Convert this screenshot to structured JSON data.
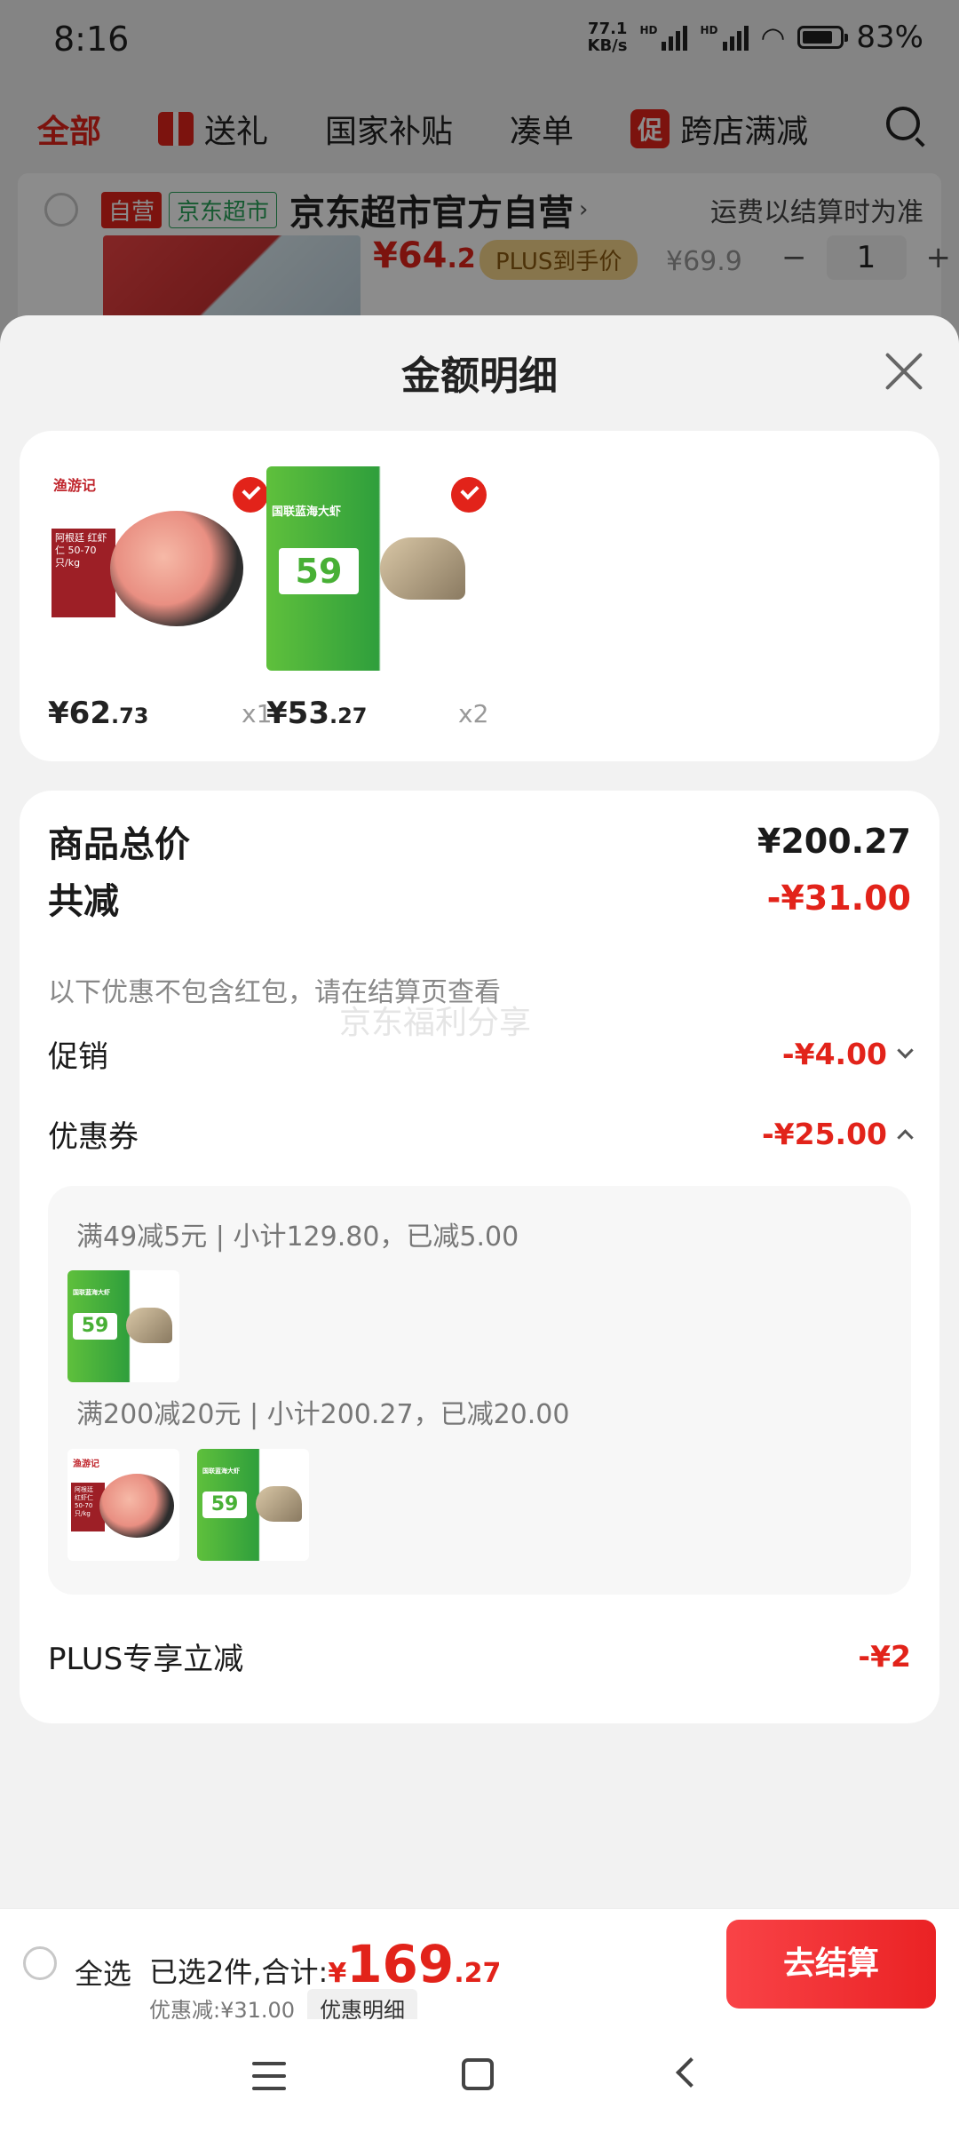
{
  "status": {
    "time": "8:16",
    "netspeed_value": "77.1",
    "netspeed_unit": "KB/s",
    "hd": "HD",
    "battery": "83%"
  },
  "topnav": {
    "items": [
      "全部",
      "送礼",
      "国家补贴",
      "凑单",
      "跨店满减"
    ],
    "promo_tag": "促"
  },
  "store": {
    "badge_self": "自营",
    "badge_super": "京东超市",
    "name": "京东超市官方自营",
    "arrow": "›",
    "shipping_note": "运费以结算时为准",
    "price_int": "¥64",
    "price_dec": ".2",
    "plus_label": "PLUS到手价",
    "orig_price": "¥69.9",
    "minus": "−",
    "qty": "1",
    "plus": "+"
  },
  "sheet": {
    "title": "金额明细",
    "products": [
      {
        "price_int": "¥62",
        "price_dec": ".73",
        "qty": "x1",
        "logo": "渔游记",
        "tag": "阿根廷 红虾仁 50-70只/kg"
      },
      {
        "price_int": "¥53",
        "price_dec": ".27",
        "qty": "x2",
        "label": "国联蓝海大虾",
        "num": "59"
      }
    ],
    "total_label": "商品总价",
    "total_value": "¥200.27",
    "reduce_label": "共减",
    "reduce_value": "-¥31.00",
    "reduce_note": "以下优惠不包含红包，请在结算页查看",
    "watermark": "京东福利分享",
    "promo_label": "促销",
    "promo_value": "-¥4.00",
    "coupon_label": "优惠券",
    "coupon_value": "-¥25.00",
    "coupon_line1": "满49减5元 | 小计129.80，已减5.00",
    "coupon_line2": "满200减20元 | 小计200.27，已减20.00",
    "plus_label": "PLUS专享立减",
    "plus_value": "-¥2"
  },
  "checkout": {
    "select_all": "全选",
    "selected_text": "已选2件,合计:",
    "total_yen": "¥",
    "total_int": "169",
    "total_dec": ".27",
    "discount_text": "优惠减:¥31.00",
    "detail_button": "优惠明细",
    "go_button": "去结算"
  },
  "colors": {
    "accent_red": "#e2231a",
    "green": "#29a35a"
  },
  "icons": [
    "close-icon",
    "check-icon",
    "search-icon",
    "gift-icon",
    "menu-icon",
    "home-icon",
    "back-icon"
  ]
}
